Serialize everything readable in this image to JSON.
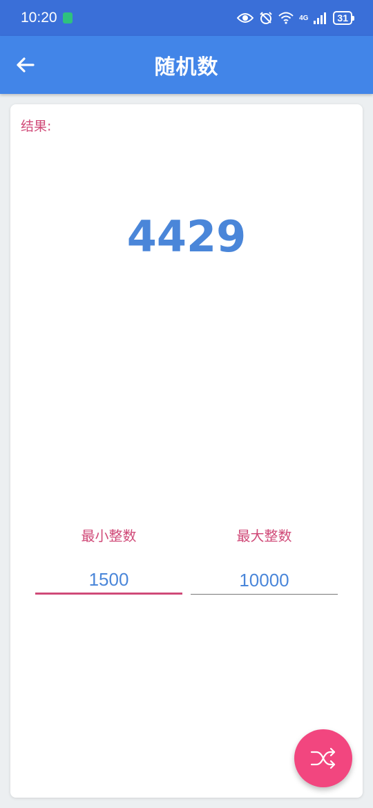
{
  "status_bar": {
    "time": "10:20",
    "network": "4G",
    "battery": "31"
  },
  "app_bar": {
    "title": "随机数",
    "back_icon": "arrow-left-icon",
    "color": "#4285e8"
  },
  "result": {
    "label": "结果:",
    "value": "4429"
  },
  "range": {
    "min_label": "最小整数",
    "min_value": "1500",
    "max_label": "最大整数",
    "max_value": "10000"
  },
  "fab": {
    "icon": "shuffle-icon",
    "color": "#f2467f"
  },
  "colors": {
    "accent_pink": "#d04a78",
    "value_blue": "#4a86d9",
    "status_blue": "#3a6fd8"
  }
}
